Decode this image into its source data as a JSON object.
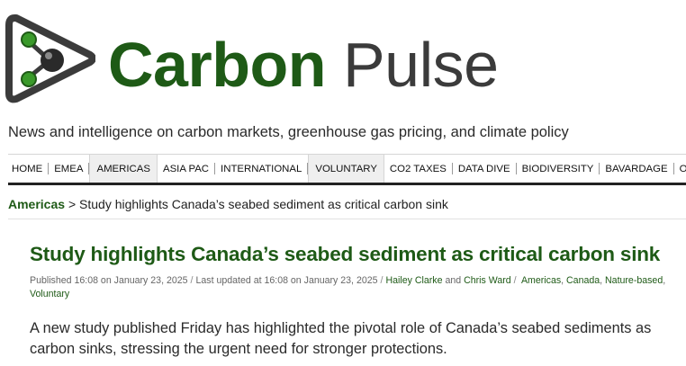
{
  "brand": {
    "name_part1": "Carbon",
    "name_part2": "Pulse",
    "tagline": "News and intelligence on carbon markets, greenhouse gas pricing, and climate policy"
  },
  "nav": {
    "items": [
      {
        "label": "HOME",
        "highlighted": false
      },
      {
        "label": "EMEA",
        "highlighted": false
      },
      {
        "label": "AMERICAS",
        "highlighted": true
      },
      {
        "label": "ASIA PAC",
        "highlighted": false
      },
      {
        "label": "INTERNATIONAL",
        "highlighted": false
      },
      {
        "label": "VOLUNTARY",
        "highlighted": true
      },
      {
        "label": "CO2 TAXES",
        "highlighted": false
      },
      {
        "label": "DATA DIVE",
        "highlighted": false
      },
      {
        "label": "BIODIVERSITY",
        "highlighted": false
      },
      {
        "label": "BAVARDAGE",
        "highlighted": false
      },
      {
        "label": "OTHER C",
        "highlighted": false
      }
    ]
  },
  "breadcrumb": {
    "section": "Americas",
    "separator": ">",
    "current": "Study highlights Canada’s seabed sediment as critical carbon sink"
  },
  "article": {
    "title": "Study highlights Canada’s seabed sediment as critical carbon sink",
    "published": "Published 16:08 on January 23, 2025",
    "sep1": "/",
    "updated": "Last updated at 16:08 on January 23, 2025",
    "sep2": "/",
    "author1": "Hailey Clarke",
    "author_join": "and",
    "author2": "Chris Ward",
    "sep3": "/",
    "tag1": "Americas",
    "tag2": "Canada",
    "tag3": "Nature-based",
    "tag4": "Voluntary",
    "lede": "A new study published Friday has highlighted the pivotal role of Canada’s seabed sediments as carbon sinks, stressing the urgent need for stronger protections."
  },
  "colors": {
    "brand_green": "#1e5a16",
    "brand_gray": "#3b3b3b"
  }
}
